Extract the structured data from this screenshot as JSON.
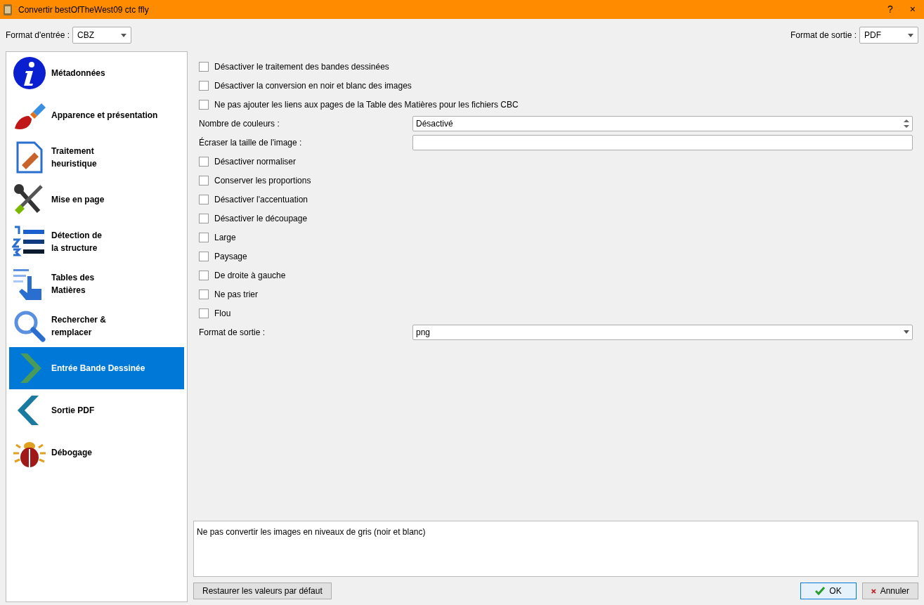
{
  "window": {
    "title": "Convertir bestOfTheWest09 ctc ffly",
    "help": "?",
    "close": "×"
  },
  "input_format": {
    "label": "Format d'entrée :",
    "value": "CBZ"
  },
  "output_format": {
    "label": "Format de sortie :",
    "value": "PDF"
  },
  "sidebar": {
    "items": [
      {
        "label": "Métadonnées",
        "selected": false
      },
      {
        "label": "Apparence et présentation",
        "selected": false
      },
      {
        "label": "Traitement heuristique",
        "selected": false
      },
      {
        "label": "Mise en page",
        "selected": false
      },
      {
        "label": "Détection de la structure",
        "selected": false
      },
      {
        "label": "Tables des Matières",
        "selected": false
      },
      {
        "label": "Rechercher & remplacer",
        "selected": false
      },
      {
        "label": "Entrée Bande Dessinée",
        "selected": true
      },
      {
        "label": "Sortie PDF",
        "selected": false
      },
      {
        "label": "Débogage",
        "selected": false
      }
    ]
  },
  "options": [
    {
      "kind": "checkbox",
      "label": "Désactiver le traitement des bandes dessinées",
      "checked": false
    },
    {
      "kind": "checkbox",
      "label": "Désactiver la conversion en noir et blanc des images",
      "checked": false
    },
    {
      "kind": "checkbox",
      "label": "Ne pas ajouter les liens aux pages de la Table des Matières pour les fichiers CBC",
      "checked": false
    },
    {
      "kind": "spin",
      "label": "Nombre de couleurs :",
      "value": "Désactivé"
    },
    {
      "kind": "text",
      "label": "Écraser la taille de l'image :"
    },
    {
      "kind": "checkbox",
      "label": "Désactiver normaliser",
      "checked": false
    },
    {
      "kind": "checkbox",
      "label": "Conserver les proportions",
      "checked": false
    },
    {
      "kind": "checkbox",
      "label": "Désactiver l'accentuation",
      "checked": false
    },
    {
      "kind": "checkbox",
      "label": "Désactiver le découpage",
      "checked": false
    },
    {
      "kind": "checkbox",
      "label": "Large",
      "checked": false
    },
    {
      "kind": "checkbox",
      "label": "Paysage",
      "checked": false
    },
    {
      "kind": "checkbox",
      "label": "De droite à gauche",
      "checked": false
    },
    {
      "kind": "checkbox",
      "label": "Ne pas trier",
      "checked": false
    },
    {
      "kind": "checkbox",
      "label": "Flou",
      "checked": false
    },
    {
      "kind": "select",
      "label": "Format de sortie :",
      "value": "png"
    }
  ],
  "help_text": "Ne pas convertir les images en niveaux de gris (noir et blanc)",
  "buttons": {
    "restore": "Restaurer les valeurs par défaut",
    "ok": "OK",
    "cancel": "Annuler"
  }
}
